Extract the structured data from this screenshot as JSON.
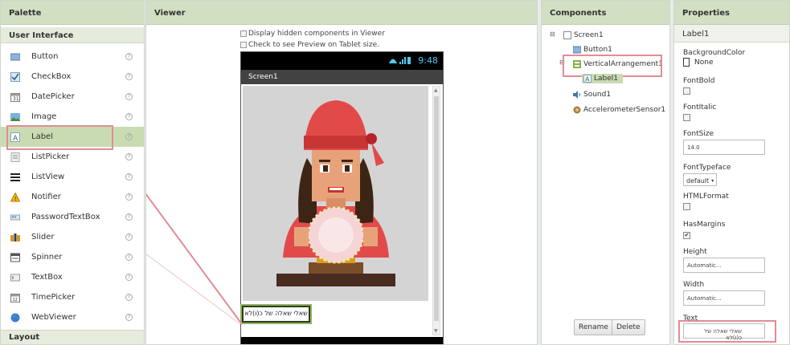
{
  "palette": {
    "title": "Palette",
    "section": "User Interface",
    "items": [
      {
        "label": "Button",
        "icon": "button-icon"
      },
      {
        "label": "CheckBox",
        "icon": "checkbox-icon"
      },
      {
        "label": "DatePicker",
        "icon": "datepicker-icon"
      },
      {
        "label": "Image",
        "icon": "image-icon"
      },
      {
        "label": "Label",
        "icon": "label-icon"
      },
      {
        "label": "ListPicker",
        "icon": "listpicker-icon"
      },
      {
        "label": "ListView",
        "icon": "listview-icon"
      },
      {
        "label": "Notifier",
        "icon": "notifier-icon"
      },
      {
        "label": "PasswordTextBox",
        "icon": "password-icon"
      },
      {
        "label": "Slider",
        "icon": "slider-icon"
      },
      {
        "label": "Spinner",
        "icon": "spinner-icon"
      },
      {
        "label": "TextBox",
        "icon": "textbox-icon"
      },
      {
        "label": "TimePicker",
        "icon": "timepicker-icon"
      },
      {
        "label": "WebViewer",
        "icon": "webviewer-icon"
      }
    ],
    "layout_section": "Layout"
  },
  "viewer": {
    "title": "Viewer",
    "option_hidden": "Display hidden components in Viewer",
    "option_tablet": "Check to see Preview on Tablet size.",
    "phone": {
      "time": "9:48",
      "screen_title": "Screen1",
      "label_text": "שאלי שאלה של כ(ו)לא"
    }
  },
  "components": {
    "title": "Components",
    "tree": {
      "screen": "Screen1",
      "button": "Button1",
      "arrangement": "VerticalArrangement1",
      "label": "Label1",
      "sound": "Sound1",
      "sensor": "AccelerometerSensor1"
    },
    "rename_label": "Rename",
    "delete_label": "Delete"
  },
  "properties": {
    "title": "Properties",
    "component_name": "Label1",
    "background_color_label": "BackgroundColor",
    "background_color_value": "None",
    "font_bold_label": "FontBold",
    "font_italic_label": "FontItalic",
    "font_size_label": "FontSize",
    "font_size_value": "14.0",
    "font_typeface_label": "FontTypeface",
    "font_typeface_value": "default",
    "html_format_label": "HTMLFormat",
    "has_margins_label": "HasMargins",
    "height_label": "Height",
    "height_value": "Automatic...",
    "width_label": "Width",
    "width_value": "Automatic...",
    "text_label": "Text",
    "text_value": "שאלי שאלה של כ(ו)לא"
  },
  "colors": {
    "header_green": "#d2dfc2",
    "selection_green": "#c9dcb1",
    "highlight_pink": "#e38c93",
    "status_blue": "#4ec9f0"
  }
}
